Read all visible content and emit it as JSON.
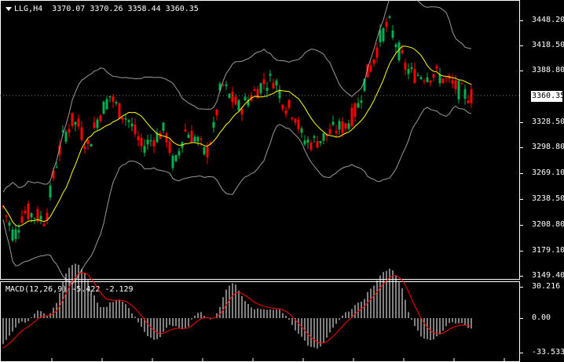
{
  "main": {
    "title": "LLG,H4",
    "ohlc": "3370.07 3370.26 3358.44 3360.35",
    "price_axis": [
      "3448.20",
      "3418.50",
      "3388.80",
      "3358.05",
      "3328.50",
      "3298.80",
      "3269.10",
      "3238.50",
      "3208.80",
      "3179.10",
      "3149.40"
    ],
    "current_price": "3360.35"
  },
  "macd": {
    "title": "MACD(12,26,9) -5.422 -2.129",
    "axis": [
      "30.216",
      "0.00",
      "-33.533"
    ]
  },
  "colors": {
    "bull": "#00b050",
    "bear": "#ff0000",
    "ma": "#ffff00",
    "bands": "#c0c0c0",
    "signal": "#ff0000",
    "hist": "#ffffff"
  }
}
